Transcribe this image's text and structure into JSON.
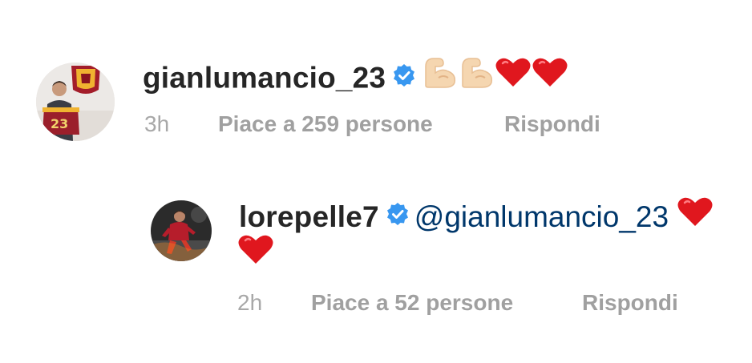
{
  "comments": [
    {
      "username": "gianlumancio_23",
      "verified": true,
      "text_emojis": [
        "flexed-biceps-emoji",
        "flexed-biceps-emoji",
        "red-heart-emoji",
        "red-heart-emoji"
      ],
      "time": "3h",
      "likes": "Piace a 259 persone",
      "reply": "Rispondi"
    },
    {
      "username": "lorepelle7",
      "verified": true,
      "mention": "@gianlumancio_23",
      "text_emojis": [
        "red-heart-emoji",
        "red-heart-emoji"
      ],
      "time": "2h",
      "likes": "Piace a 52 persone",
      "reply": "Rispondi"
    }
  ],
  "colors": {
    "text": "#262626",
    "meta": "#a0a0a0",
    "mention": "#00376b",
    "verified": "#3897f0",
    "heart": "#e0171e",
    "biceps": "#f5d6b0"
  }
}
